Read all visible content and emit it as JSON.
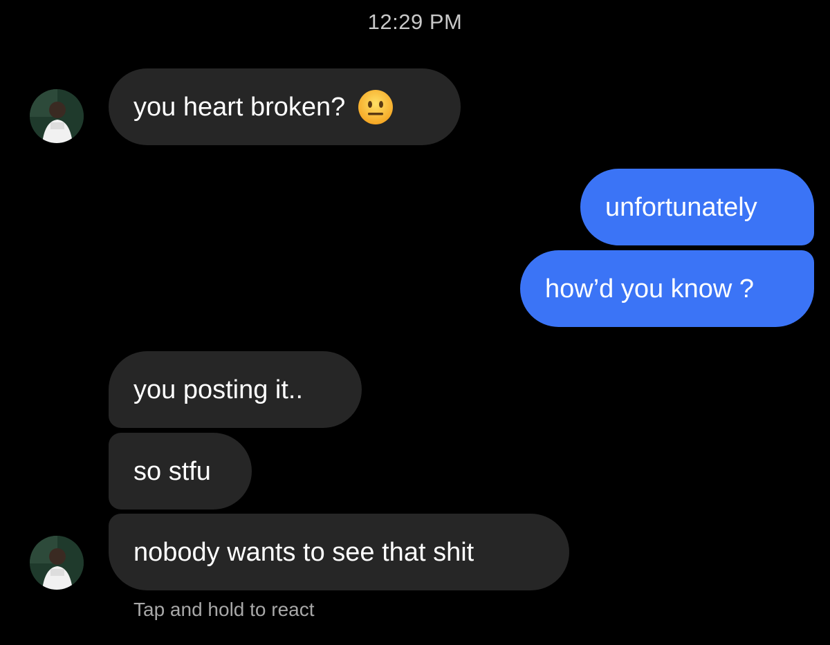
{
  "conversation": {
    "timestamp": "12:29 PM",
    "messages": [
      {
        "sender": "them",
        "text": "you heart broken?",
        "emoji": "neutral-face-icon"
      },
      {
        "sender": "me",
        "text": "unfortunately"
      },
      {
        "sender": "me",
        "text": "how’d you know ?"
      },
      {
        "sender": "them",
        "text": "you posting it.."
      },
      {
        "sender": "them",
        "text": "so stfu"
      },
      {
        "sender": "them",
        "text": "nobody wants to see that shit"
      }
    ],
    "footer_hint": "Tap and hold to react"
  },
  "colors": {
    "background": "#000000",
    "incoming_bubble": "#262626",
    "outgoing_bubble": "#3b74f6",
    "timestamp_text": "#c9c9c9",
    "hint_text": "#a8a8a8"
  }
}
